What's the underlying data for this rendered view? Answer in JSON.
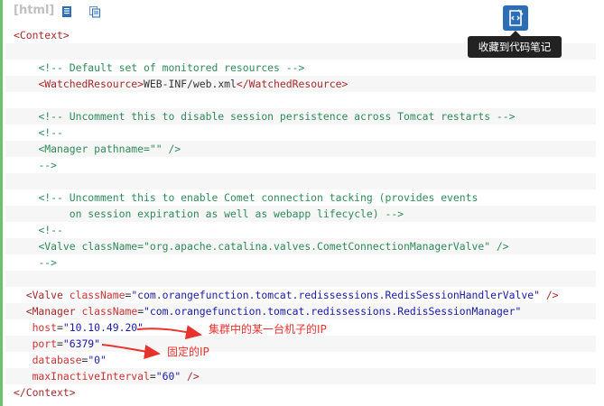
{
  "toolbar": {
    "language_label": "[html]"
  },
  "favorite": {
    "tooltip": "收藏到代码笔记",
    "icon": "code-note-icon"
  },
  "code_lines": [
    {
      "segments": [
        {
          "t": "tag",
          "v": "<Context>"
        }
      ]
    },
    {
      "segments": []
    },
    {
      "segments": [
        {
          "t": "txt",
          "v": "    "
        },
        {
          "t": "cm",
          "v": "<!-- Default set of monitored resources -->"
        }
      ]
    },
    {
      "segments": [
        {
          "t": "txt",
          "v": "    "
        },
        {
          "t": "tag",
          "v": "<WatchedResource>"
        },
        {
          "t": "txt",
          "v": "WEB-INF/web.xml"
        },
        {
          "t": "tag",
          "v": "</WatchedResource>"
        }
      ]
    },
    {
      "segments": []
    },
    {
      "segments": [
        {
          "t": "txt",
          "v": "    "
        },
        {
          "t": "cm",
          "v": "<!-- Uncomment this to disable session persistence across Tomcat restarts -->"
        }
      ]
    },
    {
      "segments": [
        {
          "t": "txt",
          "v": "    "
        },
        {
          "t": "cm",
          "v": "<!--"
        }
      ]
    },
    {
      "segments": [
        {
          "t": "txt",
          "v": "    "
        },
        {
          "t": "cm",
          "v": "<Manager pathname=\"\" />"
        }
      ]
    },
    {
      "segments": [
        {
          "t": "txt",
          "v": "    "
        },
        {
          "t": "cm",
          "v": "-->"
        }
      ]
    },
    {
      "segments": []
    },
    {
      "segments": [
        {
          "t": "txt",
          "v": "    "
        },
        {
          "t": "cm",
          "v": "<!-- Uncomment this to enable Comet connection tacking (provides events"
        }
      ]
    },
    {
      "segments": [
        {
          "t": "txt",
          "v": "         "
        },
        {
          "t": "cm",
          "v": "on session expiration as well as webapp lifecycle) -->"
        }
      ]
    },
    {
      "segments": [
        {
          "t": "txt",
          "v": "    "
        },
        {
          "t": "cm",
          "v": "<!--"
        }
      ]
    },
    {
      "segments": [
        {
          "t": "txt",
          "v": "    "
        },
        {
          "t": "cm",
          "v": "<Valve className=\"org.apache.catalina.valves.CometConnectionManagerValve\" />"
        }
      ]
    },
    {
      "segments": [
        {
          "t": "txt",
          "v": "    "
        },
        {
          "t": "cm",
          "v": "-->"
        }
      ]
    },
    {
      "segments": []
    },
    {
      "segments": [
        {
          "t": "txt",
          "v": "  "
        },
        {
          "t": "tag",
          "v": "<Valve "
        },
        {
          "t": "attr",
          "v": "className"
        },
        {
          "t": "txt",
          "v": "="
        },
        {
          "t": "val",
          "v": "\"com.orangefunction.tomcat.redissessions.RedisSessionHandlerValve\""
        },
        {
          "t": "txt",
          "v": " "
        },
        {
          "t": "tag",
          "v": "/>"
        }
      ]
    },
    {
      "segments": [
        {
          "t": "txt",
          "v": "  "
        },
        {
          "t": "tag",
          "v": "<Manager "
        },
        {
          "t": "attr",
          "v": "className"
        },
        {
          "t": "txt",
          "v": "="
        },
        {
          "t": "val",
          "v": "\"com.orangefunction.tomcat.redissessions.RedisSessionManager\""
        }
      ]
    },
    {
      "segments": [
        {
          "t": "txt",
          "v": "   "
        },
        {
          "t": "attr",
          "v": "host"
        },
        {
          "t": "txt",
          "v": "="
        },
        {
          "t": "val",
          "v": "\"10.10.49.20\""
        }
      ]
    },
    {
      "segments": [
        {
          "t": "txt",
          "v": "   "
        },
        {
          "t": "attr",
          "v": "port"
        },
        {
          "t": "txt",
          "v": "="
        },
        {
          "t": "val",
          "v": "\"6379\""
        }
      ]
    },
    {
      "segments": [
        {
          "t": "txt",
          "v": "   "
        },
        {
          "t": "attr",
          "v": "database"
        },
        {
          "t": "txt",
          "v": "="
        },
        {
          "t": "val",
          "v": "\"0\""
        }
      ]
    },
    {
      "segments": [
        {
          "t": "txt",
          "v": "   "
        },
        {
          "t": "attr",
          "v": "maxInactiveInterval"
        },
        {
          "t": "txt",
          "v": "="
        },
        {
          "t": "val",
          "v": "\"60\""
        },
        {
          "t": "txt",
          "v": " "
        },
        {
          "t": "tag",
          "v": "/>"
        }
      ]
    },
    {
      "segments": [
        {
          "t": "tag",
          "v": "</Context>"
        }
      ]
    }
  ],
  "annotations": {
    "host_note": "集群中的某一台机子的IP",
    "port_note": "固定的IP"
  },
  "colors": {
    "accent_border": "#6ac36a",
    "annotation_red": "#e8322d",
    "fav_button": "#2c6db4"
  }
}
